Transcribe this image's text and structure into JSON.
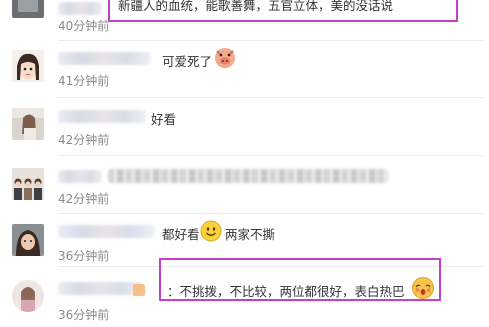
{
  "comments": [
    {
      "text": "新疆人的血统，能歌善舞，五官立体，美的没话说",
      "time": "40分钟前"
    },
    {
      "text": "可爱死了",
      "time": "41分钟前"
    },
    {
      "text": "好看",
      "time": "42分钟前"
    },
    {
      "text": "",
      "time": "42分钟前"
    },
    {
      "text_before": "都好看",
      "text_after": "两家不撕",
      "time": "36分钟前"
    },
    {
      "text": "：不挑拨，不比较，两位都很好，表白热巴",
      "time": "36分钟前"
    }
  ],
  "icons": [
    "pig-emoji-icon",
    "smile-emoji-icon",
    "shy-emoji-icon"
  ],
  "colors": {
    "highlight": "#c63fcc",
    "time": "#8a8a8a"
  }
}
